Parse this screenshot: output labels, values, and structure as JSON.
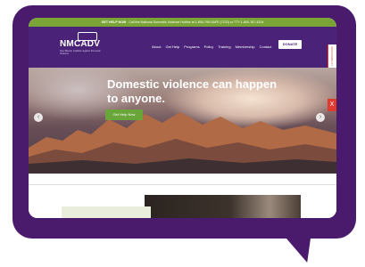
{
  "alert": {
    "lead": "GET HELP NOW",
    "text": "Call the National Domestic Violence Hotline at 1-800-799-SAFE (7233) or TTY 1-800-787-3224"
  },
  "logo": {
    "name": "NMCADV",
    "subtitle": "New Mexico Coalition Against Domestic Violence"
  },
  "nav": {
    "items": [
      "About",
      "Get Help",
      "Programs",
      "Policy",
      "Training",
      "Membership",
      "Contact"
    ],
    "donate": "DONATE"
  },
  "side_tab": "ACCESSIBILITY",
  "hero": {
    "title": "Domestic violence can happen to anyone.",
    "button": "Get Help Now",
    "prev": "‹",
    "next": "›",
    "close": "X"
  },
  "colors": {
    "bubble": "#4a1a6c",
    "alert_bar": "#7ba437",
    "nav": "#4a2378",
    "accent_green": "#6aa53a",
    "accent_red": "#e03a2e"
  }
}
